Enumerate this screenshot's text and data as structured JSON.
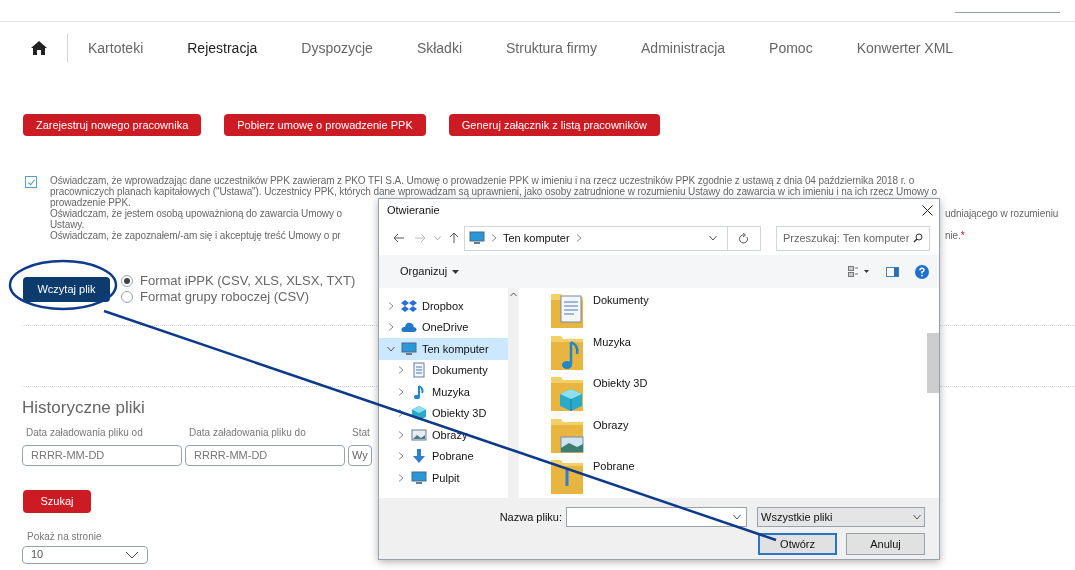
{
  "nav": {
    "items": [
      {
        "label": "Kartoteki",
        "selected": false
      },
      {
        "label": "Rejestracja",
        "selected": true
      },
      {
        "label": "Dyspozycje",
        "selected": false
      },
      {
        "label": "Składki",
        "selected": false
      },
      {
        "label": "Struktura firmy",
        "selected": false
      },
      {
        "label": "Administracja",
        "selected": false
      },
      {
        "label": "Pomoc",
        "selected": false
      },
      {
        "label": "Konwerter XML",
        "selected": false
      }
    ]
  },
  "actions": [
    "Zarejestruj nowego pracownika",
    "Pobierz umowę o prowadzenie PPK",
    "Generuj załącznik z listą pracowników"
  ],
  "declaration": {
    "checked": true,
    "lines": [
      {
        "left": "Oświadczam, że wprowadzając dane uczestników PPK zawieram z PKO TFI S.A. Umowę o prowadzenie PPK w imieniu i na rzecz uczestników PPK zgodnie z ustawą z dnia 04 października 2018 r. o"
      },
      {
        "left": "pracowniczych planach kapitałowych (\"Ustawa\"). Uczestnicy PPK, których dane wprowadzam są uprawnieni, jako osoby zatrudnione w rozumieniu Ustawy do zawarcia w ich imieniu i na ich rzecz Umowy o"
      },
      {
        "left": "prowadzenie PPK."
      },
      {
        "left": "Oświadczam, że jestem osobą upoważnioną do zawarcia Umowy o",
        "right": "udniającego w rozumieniu"
      },
      {
        "left": "Ustawy."
      },
      {
        "left": "Oświadczam, że zapoznałem/-am się i akceptuję treść Umowy o pr",
        "right": "nie.",
        "required": "*"
      }
    ]
  },
  "upload": {
    "button": "Wczytaj plik",
    "formats": [
      {
        "label": "Format iPPK (CSV, XLS, XLSX, TXT)",
        "selected": true
      },
      {
        "label": "Format grupy roboczej (CSV)",
        "selected": false
      }
    ]
  },
  "history": {
    "title": "Historyczne pliki",
    "filters": [
      {
        "label": "Data załadowania pliku od",
        "placeholder": "RRRR-MM-DD"
      },
      {
        "label": "Data załadowania pliku do",
        "placeholder": "RRRR-MM-DD"
      },
      {
        "label": "Stat",
        "value": "Wy"
      }
    ],
    "search_button": "Szukaj",
    "page_size": {
      "label": "Pokaż na stronie",
      "value": "10"
    }
  },
  "dialog": {
    "title": "Otwieranie",
    "path": "Ten komputer",
    "search_placeholder": "Przeszukaj: Ten komputer",
    "organize": "Organizuj",
    "tree": [
      {
        "label": "Dropbox",
        "kind": "dropbox",
        "expanded": false,
        "selected": false
      },
      {
        "label": "OneDrive",
        "kind": "cloud",
        "expanded": false,
        "selected": false
      },
      {
        "label": "Ten komputer",
        "kind": "computer",
        "expanded": true,
        "selected": true,
        "children": [
          {
            "label": "Dokumenty",
            "kind": "documents",
            "expanded": false,
            "selected": false
          },
          {
            "label": "Muzyka",
            "kind": "music",
            "expanded": false,
            "selected": false
          },
          {
            "label": "Obiekty 3D",
            "kind": "cube",
            "expanded": false,
            "selected": false
          },
          {
            "label": "Obrazy",
            "kind": "pictures",
            "expanded": false,
            "selected": false
          },
          {
            "label": "Pobrane",
            "kind": "downloads",
            "expanded": false,
            "selected": false
          },
          {
            "label": "Pulpit",
            "kind": "desktop",
            "expanded": false,
            "selected": false
          }
        ]
      }
    ],
    "items": [
      {
        "label": "Dokumenty",
        "kind": "documents"
      },
      {
        "label": "Muzyka",
        "kind": "music"
      },
      {
        "label": "Obiekty 3D",
        "kind": "cube"
      },
      {
        "label": "Obrazy",
        "kind": "pictures"
      },
      {
        "label": "Pobrane",
        "kind": "downloads"
      }
    ],
    "filename_label": "Nazwa pliku:",
    "file_type": "Wszystkie pliki",
    "buttons": [
      {
        "label": "Otwórz",
        "default": true
      },
      {
        "label": "Anuluj",
        "default": false
      }
    ]
  }
}
